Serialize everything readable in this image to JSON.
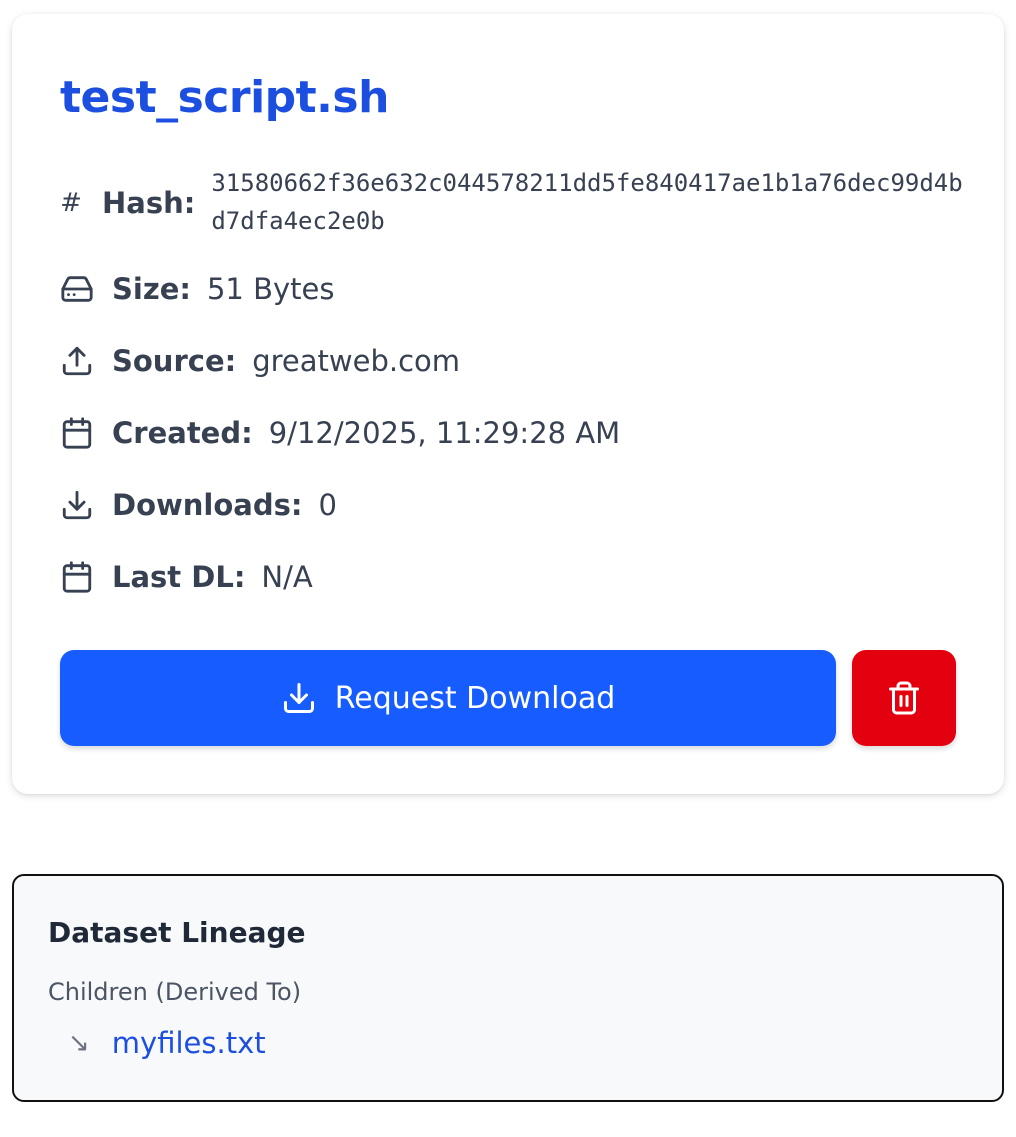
{
  "file": {
    "name": "test_script.sh",
    "hash_label": "Hash:",
    "hash_symbol": "#",
    "hash": "31580662f36e632c044578211dd5fe840417ae1b1a76dec99d4bd7dfa4ec2e0b",
    "size_label": "Size:",
    "size": "51 Bytes",
    "source_label": "Source:",
    "source": "greatweb.com",
    "created_label": "Created:",
    "created": "9/12/2025, 11:29:28 AM",
    "downloads_label": "Downloads:",
    "downloads": "0",
    "last_dl_label": "Last DL:",
    "last_dl": "N/A"
  },
  "actions": {
    "download_label": "Request Download",
    "download_color": "#175cff",
    "delete_color": "#e3000f"
  },
  "lineage": {
    "title": "Dataset Lineage",
    "children_label": "Children (Derived To)",
    "children": [
      {
        "arrow": "↘",
        "name": "myfiles.txt"
      }
    ]
  },
  "icons": {
    "hash": "hash-icon",
    "size": "hard-drive-icon",
    "source": "upload-icon",
    "created": "calendar-icon",
    "downloads": "download-icon",
    "last_dl": "calendar-icon",
    "delete": "trash-icon"
  }
}
